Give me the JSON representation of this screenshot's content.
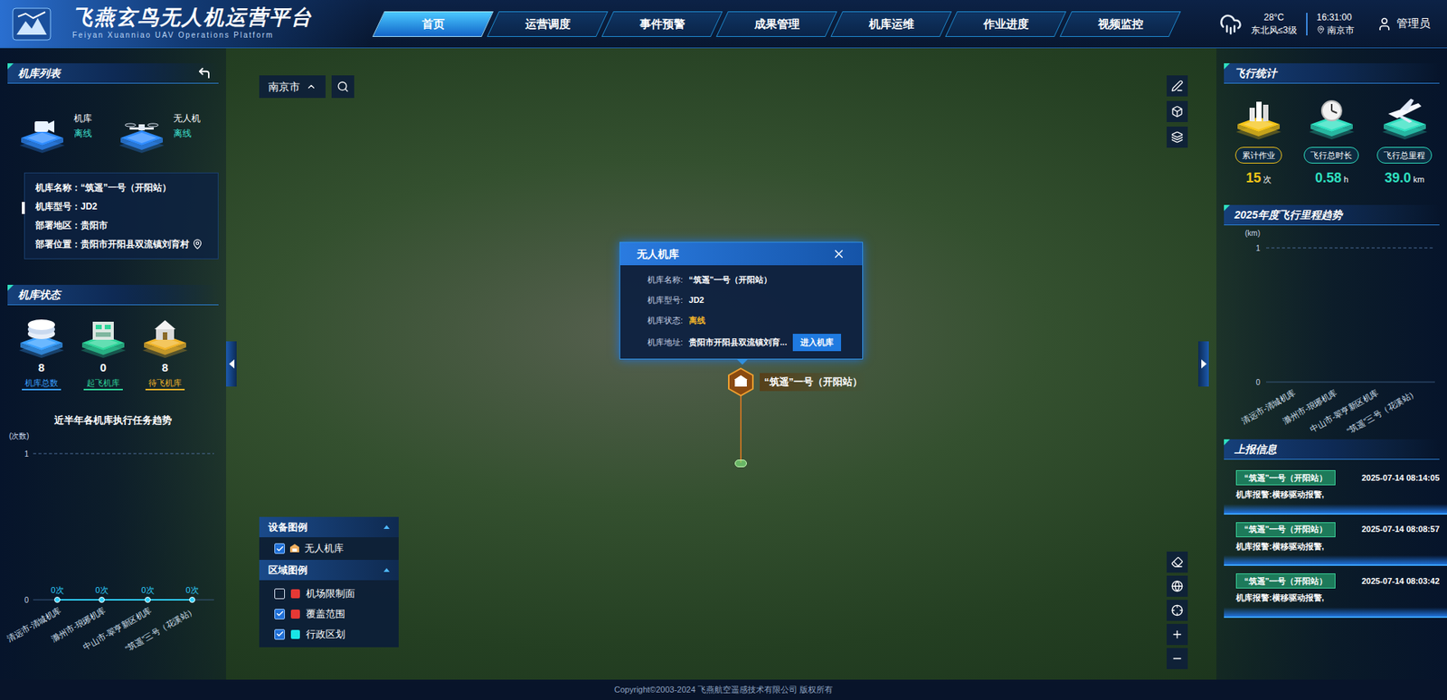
{
  "header": {
    "title": "飞燕玄鸟无人机运营平台",
    "subtitle": "Feiyan Xuanniao UAV Operations Platform"
  },
  "nav": [
    {
      "label": "首页",
      "selected": true
    },
    {
      "label": "运营调度",
      "selected": false
    },
    {
      "label": "事件预警",
      "selected": false
    },
    {
      "label": "成果管理",
      "selected": false
    },
    {
      "label": "机库运维",
      "selected": false
    },
    {
      "label": "作业进度",
      "selected": false
    },
    {
      "label": "视频监控",
      "selected": false
    }
  ],
  "weather": {
    "temperature": "28°C",
    "wind": "东北风≤3级"
  },
  "clock": {
    "time": "16:31:00",
    "city": "南京市"
  },
  "user": {
    "name": "管理员"
  },
  "hangar_list": {
    "title": "机库列表",
    "devices": [
      {
        "label": "机库",
        "status": "离线"
      },
      {
        "label": "无人机",
        "status": "离线"
      }
    ],
    "info": [
      {
        "label": "机库名称：",
        "value": "“筑遥”一号（开阳站）"
      },
      {
        "label": "机库型号：",
        "value": "JD2"
      },
      {
        "label": "部署地区：",
        "value": "贵阳市"
      },
      {
        "label": "部署位置：",
        "value": "贵阳市开阳县双流镇刘育村"
      }
    ]
  },
  "hangar_status": {
    "title": "机库状态",
    "items": [
      {
        "count": "8",
        "label": "机库总数",
        "color": "#3aa0ff"
      },
      {
        "count": "0",
        "label": "起飞机库",
        "color": "#2fd59a"
      },
      {
        "count": "8",
        "label": "待飞机库",
        "color": "#f0b429"
      }
    ]
  },
  "task_chart": {
    "title": "近半年各机库执行任务趋势",
    "unit": "(次数)",
    "y_ticks": [
      "1",
      "0"
    ],
    "y_max": 1,
    "categories": [
      "清远市-清城机库",
      "滁州市-琅琊机库",
      "中山市-翠亨新区机库",
      "“筑遥”三号（花溪站）"
    ],
    "values": [
      0,
      0,
      0,
      0
    ],
    "value_labels": [
      "0次",
      "0次",
      "0次",
      "0次"
    ]
  },
  "search": {
    "city": "南京市"
  },
  "popup": {
    "title": "无人机库",
    "fields": [
      {
        "label": "机库名称:",
        "value": "“筑遥”一号（开阳站）",
        "color": "#ffffff"
      },
      {
        "label": "机库型号:",
        "value": "JD2",
        "color": "#ffffff"
      },
      {
        "label": "机库状态:",
        "value": "离线",
        "color": "#f0b429"
      },
      {
        "label": "机库地址:",
        "value": "贵阳市开阳县双流镇刘育...",
        "color": "#ffffff"
      }
    ],
    "button": "进入机库"
  },
  "marker": {
    "label": "“筑遥”一号（开阳站）"
  },
  "legend": {
    "device_title": "设备图例",
    "devices": [
      {
        "label": "无人机库",
        "checked": true
      }
    ],
    "area_title": "区域图例",
    "areas": [
      {
        "label": "机场限制面",
        "checked": false,
        "color": "#e53935"
      },
      {
        "label": "覆盖范围",
        "checked": true,
        "color": "#e53935"
      },
      {
        "label": "行政区划",
        "checked": true,
        "color": "#19e6e6"
      }
    ]
  },
  "flight_stats": {
    "title": "飞行统计",
    "items": [
      {
        "label": "累计作业",
        "value": "15",
        "unit": "次",
        "color": "#f5c518"
      },
      {
        "label": "飞行总时长",
        "value": "0.58",
        "unit": "h",
        "color": "#2fe0c0"
      },
      {
        "label": "飞行总里程",
        "value": "39.0",
        "unit": "km",
        "color": "#2fe0c0"
      }
    ]
  },
  "mileage_chart": {
    "title": "2025年度飞行里程趋势",
    "unit": "(km)",
    "y_ticks": [
      "1",
      "0"
    ],
    "y_max": 1,
    "categories": [
      "清远市-清城机库",
      "滁州市-琅琊机库",
      "中山市-翠亨新区机库",
      "“筑遥”三号（花溪站）"
    ],
    "values": []
  },
  "reports": {
    "title": "上报信息",
    "items": [
      {
        "source": "“筑遥”一号（开阳站）",
        "time": "2025-07-14 08:14:05",
        "message": "机库报警:横移驱动报警,"
      },
      {
        "source": "“筑遥”一号（开阳站）",
        "time": "2025-07-14 08:08:57",
        "message": "机库报警:横移驱动报警,"
      },
      {
        "source": "“筑遥”一号（开阳站）",
        "time": "2025-07-14 08:03:42",
        "message": "机库报警:横移驱动报警,"
      }
    ]
  },
  "footer": "Copyright©2003-2024 飞燕航空遥感技术有限公司 版权所有"
}
